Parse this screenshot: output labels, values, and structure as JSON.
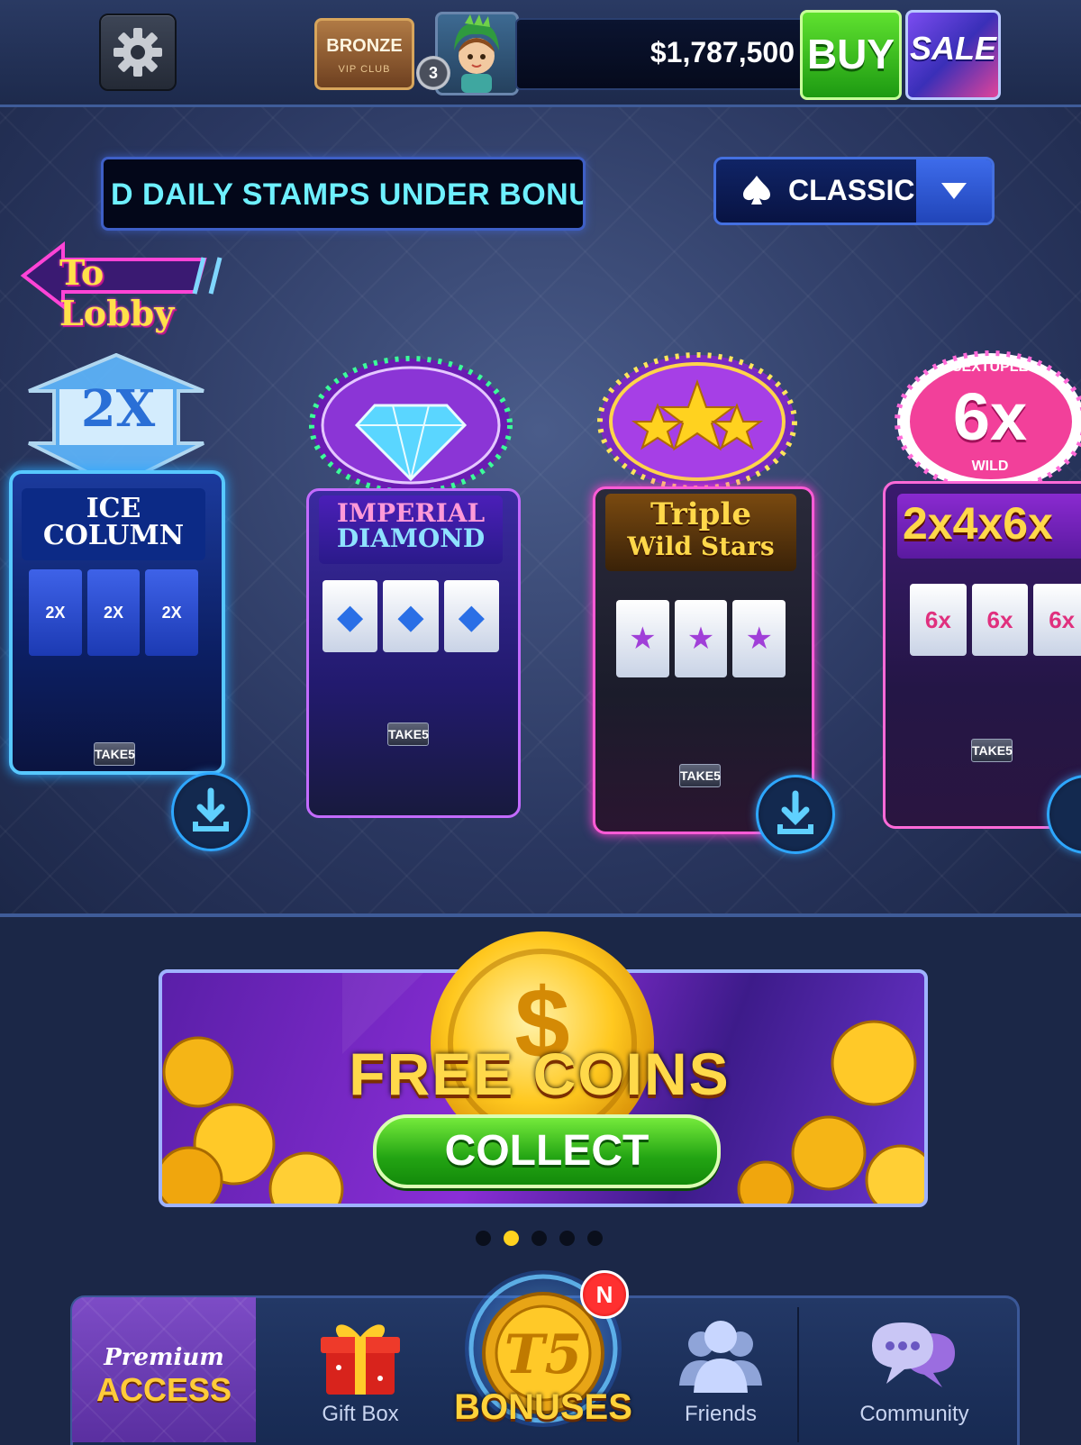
{
  "header": {
    "vip_tier": "BRONZE",
    "vip_club": "VIP CLUB",
    "level": "3",
    "balance": "$1,787,500",
    "buy_label": "BUY",
    "sale_label": "SALE"
  },
  "ticker": {
    "text": "D DAILY STAMPS UNDER BONU"
  },
  "filter": {
    "selected": "CLASSIC",
    "icon": "spade-icon"
  },
  "to_lobby": "To Lobby",
  "machines": [
    {
      "title_line1": "ICE",
      "title_line2": "COLUMN",
      "topper": "2X",
      "reel_symbol": "2X",
      "plate": "TAKE5",
      "downloadable": true
    },
    {
      "title_line1": "IMPERIAL",
      "title_line2": "DIAMOND",
      "topper": "IMPERIAL DIAMOND",
      "reel_symbol": "◆",
      "plate": "TAKE5",
      "downloadable": false
    },
    {
      "title_line1": "Triple",
      "title_line2": "Wild Stars",
      "topper": "TRIPLE WILD STAR",
      "reel_symbol": "★",
      "plate": "TAKE5",
      "downloadable": true
    },
    {
      "title_line1": "2x4x6x",
      "title_line2": "",
      "topper": "6x",
      "topper_sub": "SEXTUPLE",
      "topper_wild": "WILD",
      "reel_symbol": "6x",
      "plate": "TAKE5",
      "downloadable": true
    }
  ],
  "banner": {
    "title": "FREE COINS",
    "button": "COLLECT",
    "pages": 5,
    "active_page": 2
  },
  "bottom_nav": {
    "premium_line1": "Premium",
    "premium_line2": "ACCESS",
    "gift_box": "Gift Box",
    "bonuses": "BONUSES",
    "bonuses_badge": "N",
    "friends": "Friends",
    "community": "Community"
  }
}
